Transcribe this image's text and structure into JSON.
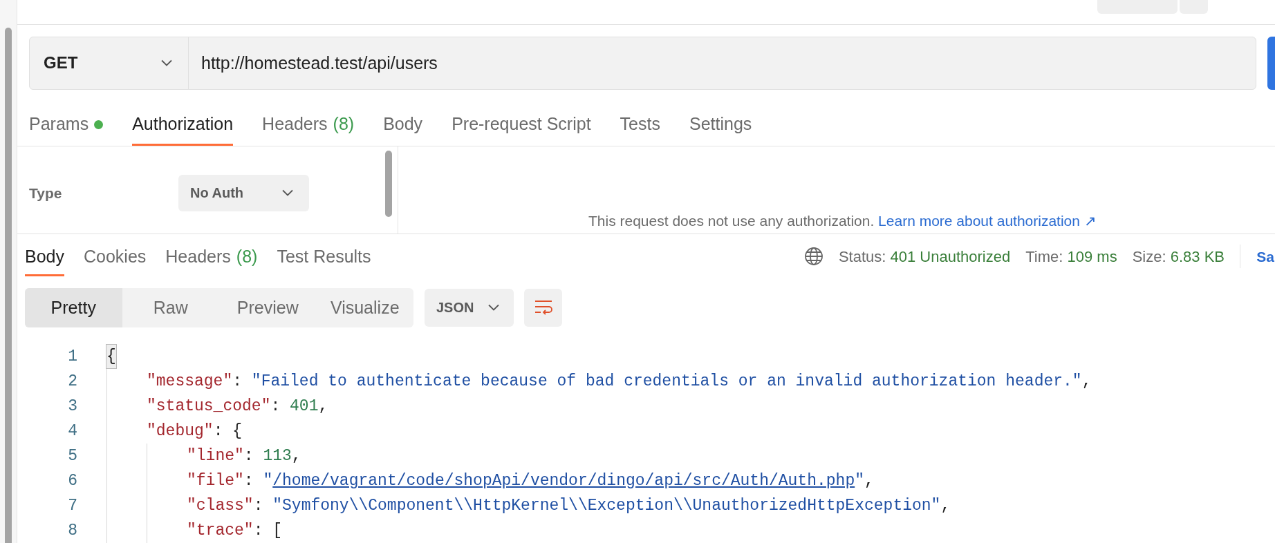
{
  "request": {
    "method": "GET",
    "url": "http://homestead.test/api/users"
  },
  "request_tabs": [
    {
      "label": "Params",
      "has_dot": true,
      "selected": false
    },
    {
      "label": "Authorization",
      "has_dot": false,
      "selected": true
    },
    {
      "label": "Headers",
      "count": "(8)",
      "has_dot": false,
      "selected": false
    },
    {
      "label": "Body",
      "has_dot": false,
      "selected": false
    },
    {
      "label": "Pre-request Script",
      "has_dot": false,
      "selected": false
    },
    {
      "label": "Tests",
      "has_dot": false,
      "selected": false
    },
    {
      "label": "Settings",
      "has_dot": false,
      "selected": false
    }
  ],
  "auth": {
    "type_label": "Type",
    "type_value": "No Auth",
    "message": "This request does not use any authorization.",
    "link": "Learn more about authorization ↗"
  },
  "response_tabs": [
    {
      "label": "Body",
      "selected": true
    },
    {
      "label": "Cookies",
      "selected": false
    },
    {
      "label": "Headers",
      "count": "(8)",
      "selected": false
    },
    {
      "label": "Test Results",
      "selected": false
    }
  ],
  "response_meta": {
    "status_label": "Status:",
    "status": "401 Unauthorized",
    "time_label": "Time:",
    "time": "109 ms",
    "size_label": "Size:",
    "size": "6.83 KB",
    "save": "Sa"
  },
  "view_modes": [
    {
      "label": "Pretty",
      "selected": true
    },
    {
      "label": "Raw",
      "selected": false
    },
    {
      "label": "Preview",
      "selected": false
    },
    {
      "label": "Visualize",
      "selected": false
    }
  ],
  "format": "JSON",
  "code_lines": [
    {
      "number": "1",
      "tokens": [
        {
          "kind": "brace_match",
          "text": "{"
        }
      ],
      "children": [
        {
          "number": "2",
          "tokens": [
            {
              "kind": "key",
              "text": "\"message\""
            },
            {
              "kind": "punct",
              "text": ": "
            },
            {
              "kind": "string",
              "text": "\"Failed to authenticate because of bad credentials or an invalid authorization header.\""
            },
            {
              "kind": "punct",
              "text": ","
            }
          ]
        },
        {
          "number": "3",
          "tokens": [
            {
              "kind": "key",
              "text": "\"status_code\""
            },
            {
              "kind": "punct",
              "text": ": "
            },
            {
              "kind": "number",
              "text": "401"
            },
            {
              "kind": "punct",
              "text": ","
            }
          ]
        },
        {
          "number": "4",
          "tokens": [
            {
              "kind": "key",
              "text": "\"debug\""
            },
            {
              "kind": "punct",
              "text": ": {"
            }
          ],
          "children": [
            {
              "number": "5",
              "tokens": [
                {
                  "kind": "key",
                  "text": "\"line\""
                },
                {
                  "kind": "punct",
                  "text": ": "
                },
                {
                  "kind": "number",
                  "text": "113"
                },
                {
                  "kind": "punct",
                  "text": ","
                }
              ]
            },
            {
              "number": "6",
              "tokens": [
                {
                  "kind": "key",
                  "text": "\"file\""
                },
                {
                  "kind": "punct",
                  "text": ": "
                },
                {
                  "kind": "string",
                  "text": "\""
                },
                {
                  "kind": "link",
                  "text": "/home/vagrant/code/shopApi/vendor/dingo/api/src/Auth/Auth.php"
                },
                {
                  "kind": "string",
                  "text": "\""
                },
                {
                  "kind": "punct",
                  "text": ","
                }
              ]
            },
            {
              "number": "7",
              "tokens": [
                {
                  "kind": "key",
                  "text": "\"class\""
                },
                {
                  "kind": "punct",
                  "text": ": "
                },
                {
                  "kind": "string",
                  "text": "\"Symfony\\\\Component\\\\HttpKernel\\\\Exception\\\\UnauthorizedHttpException\""
                },
                {
                  "kind": "punct",
                  "text": ","
                }
              ]
            },
            {
              "number": "8",
              "tokens": [
                {
                  "kind": "key",
                  "text": "\"trace\""
                },
                {
                  "kind": "punct",
                  "text": ": ["
                }
              ]
            }
          ]
        }
      ]
    }
  ]
}
